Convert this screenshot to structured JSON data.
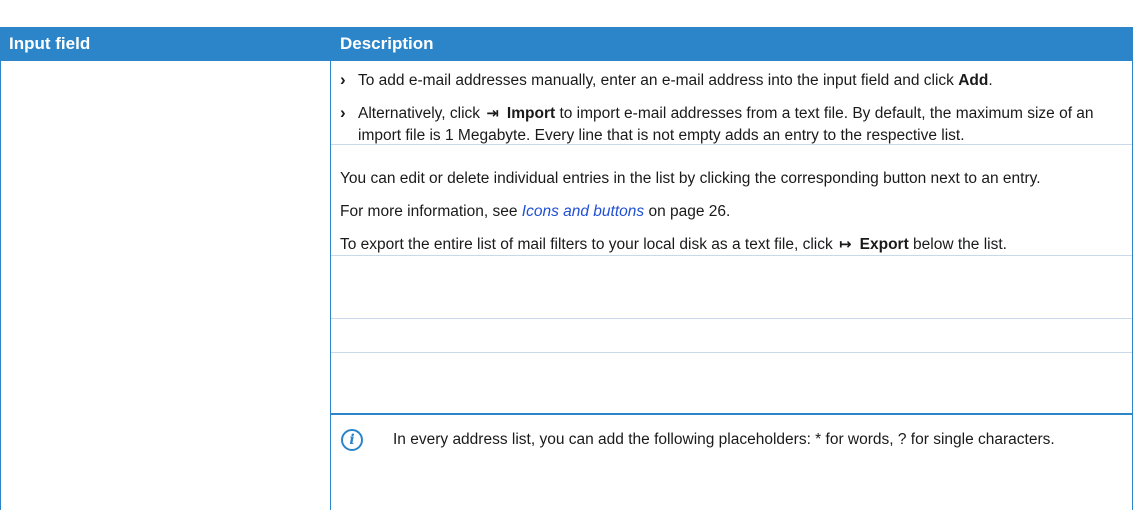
{
  "header": {
    "col1": "Input field",
    "col2": "Description"
  },
  "bullets": [
    {
      "pre": "To add e-mail addresses manually, enter an e-mail address into the input field and click ",
      "bold": "Add",
      "post": "."
    },
    {
      "pre": "Alternatively, click",
      "icon": "import-icon",
      "bold": "Import",
      "post": "to import e-mail addresses from a text file. By default, the maximum size of an import file is 1 Megabyte. Every line that is not empty adds an entry to the respective list."
    }
  ],
  "para_edit": "You can edit or delete individual entries in the list by clicking the corresponding button next to an entry.",
  "para_more": {
    "pre": "For more information, see ",
    "link": "Icons and buttons",
    "post": " on page 26."
  },
  "para_export": {
    "pre": "To export the entire list of mail filters to your local disk as a text file, click",
    "icon": "export-icon",
    "bold": "Export",
    "post": "below the list."
  },
  "note": {
    "icon": "info-icon",
    "icon_glyph": "i",
    "text": "In every address list, you can add the following placeholders: * for words, ? for single characters."
  },
  "colors": {
    "accent": "#2c85c8",
    "link": "#1f4fd4"
  }
}
